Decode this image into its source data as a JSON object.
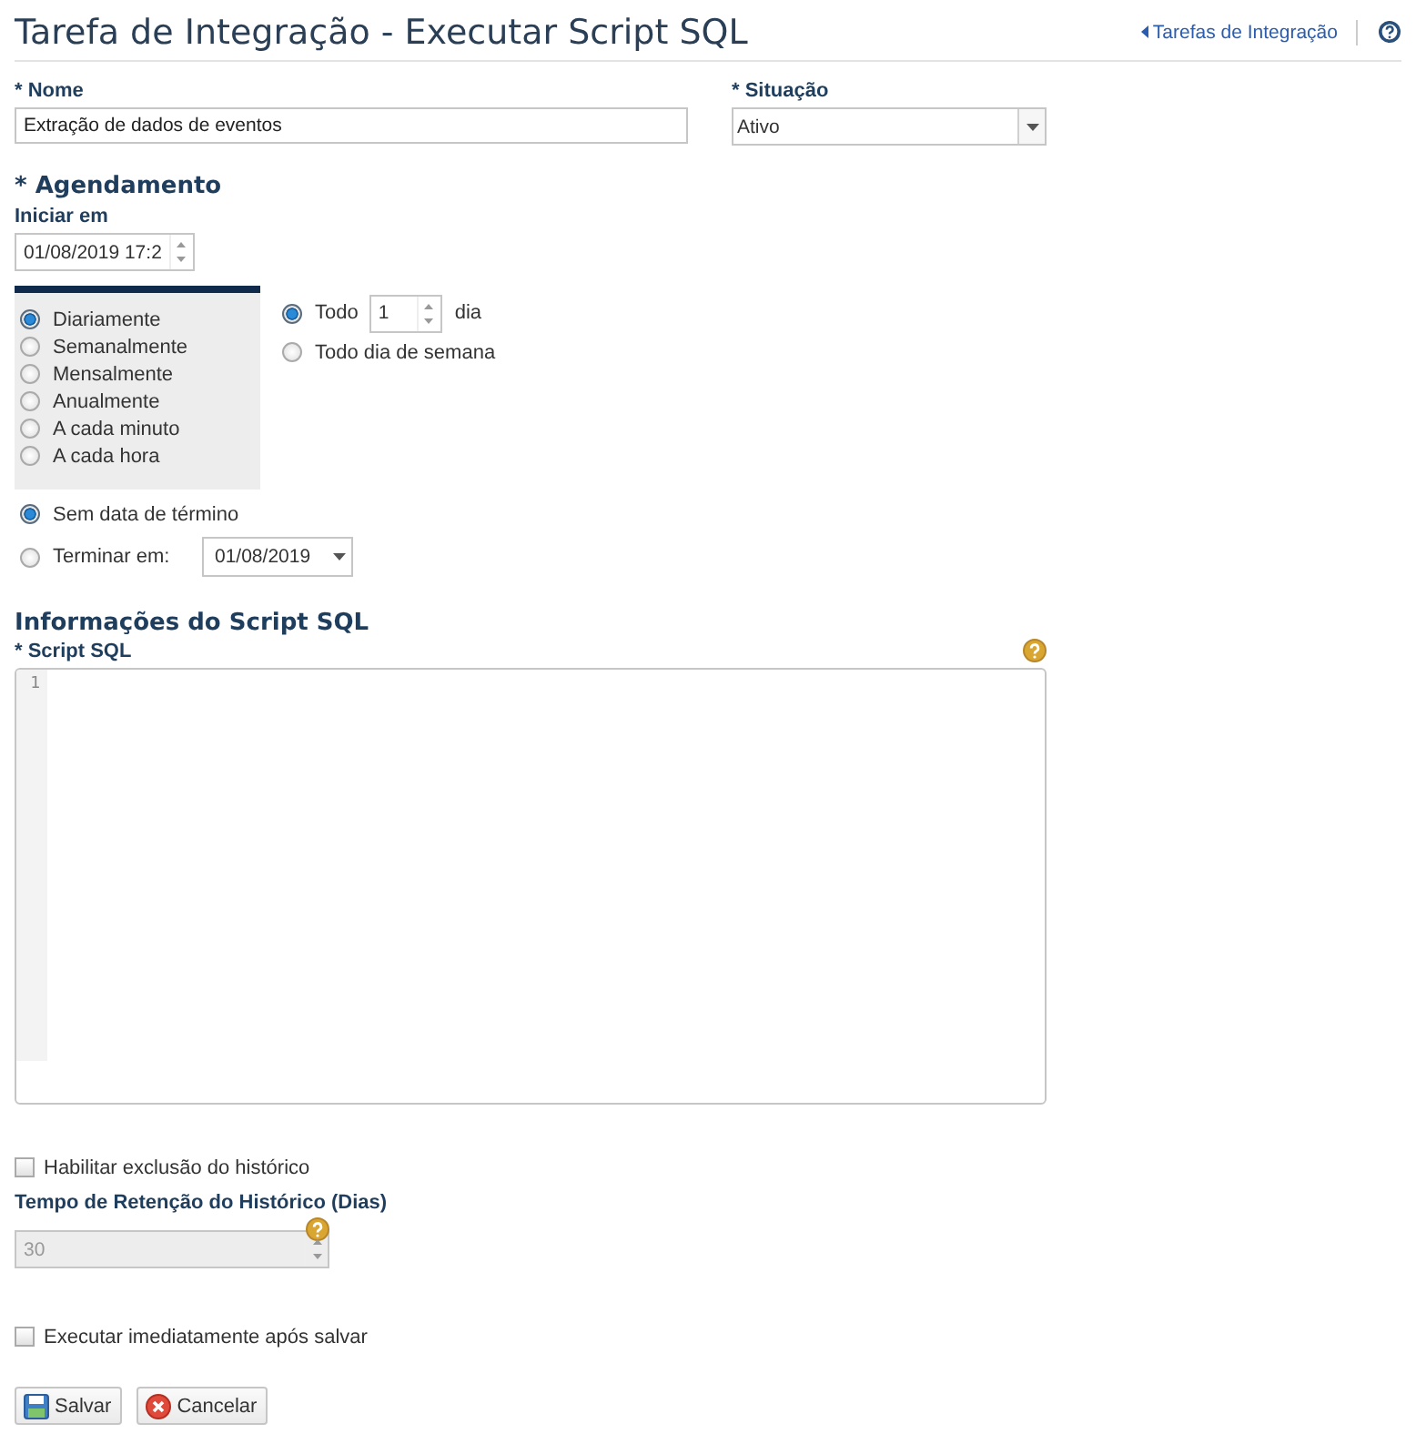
{
  "header": {
    "title": "Tarefa de Integração - Executar Script SQL",
    "back_link": "Tarefas de Integração"
  },
  "name_field": {
    "label": "* Nome",
    "value": "Extração de dados de eventos"
  },
  "status_field": {
    "label": "* Situação",
    "value": "Ativo"
  },
  "schedule": {
    "heading": "* Agendamento",
    "start_label": "Iniciar em",
    "start_value": "01/08/2019 17:2",
    "frequencies": [
      {
        "label": "Diariamente",
        "selected": true
      },
      {
        "label": "Semanalmente",
        "selected": false
      },
      {
        "label": "Mensalmente",
        "selected": false
      },
      {
        "label": "Anualmente",
        "selected": false
      },
      {
        "label": "A cada minuto",
        "selected": false
      },
      {
        "label": "A cada hora",
        "selected": false
      }
    ],
    "repeat_options": [
      {
        "kind": "interval",
        "label": "Todo",
        "value": "1",
        "unit": "dia",
        "selected": true
      },
      {
        "kind": "plain",
        "label": "Todo dia de semana",
        "selected": false
      }
    ],
    "end_options": [
      {
        "kind": "plain",
        "label": "Sem data de término",
        "selected": true
      },
      {
        "kind": "date",
        "label": "Terminar em:",
        "value": "01/08/2019",
        "selected": false
      }
    ]
  },
  "script": {
    "heading": "Informações do Script SQL",
    "label": "* Script SQL",
    "line_numbers": [
      "1"
    ]
  },
  "history": {
    "label": "Habilitar exclusão do histórico",
    "checked": false,
    "retention_label": "Tempo de Retenção do Histórico (Dias)",
    "retention_value": "30",
    "disabled": true
  },
  "run_after_save": {
    "label": "Executar imediatamente após salvar",
    "checked": false
  },
  "buttons": [
    {
      "kind": "save",
      "label": "Salvar"
    },
    {
      "kind": "cancel",
      "label": "Cancelar"
    }
  ]
}
